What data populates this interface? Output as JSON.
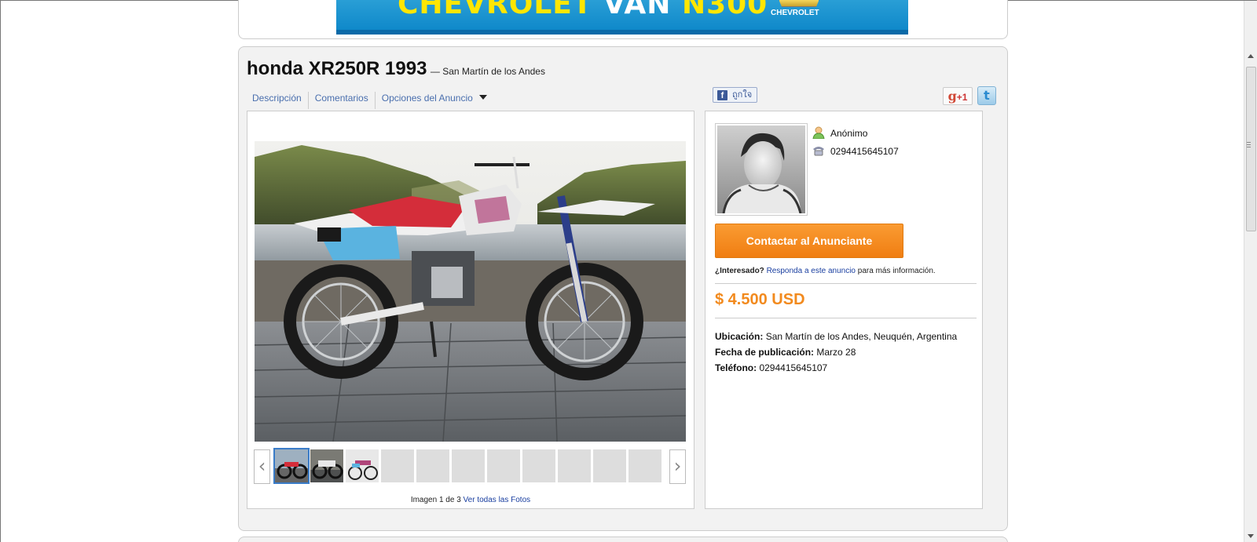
{
  "banner": {
    "text_brand": "CHEVROLET",
    "text_van": "VAN",
    "text_model": "N300",
    "brand_label": "CHEVROLET"
  },
  "listing": {
    "title": "honda XR250R 1993",
    "location_sub": "— San Martín de los Andes",
    "tabs": [
      {
        "label": "Descripción"
      },
      {
        "label": "Comentarios"
      },
      {
        "label": "Opciones del Anuncio"
      }
    ],
    "fb_like": "ถูกใจ",
    "fb_icon": "f",
    "gplus_g": "g",
    "gplus_label": "+1",
    "twitter_icon": "t"
  },
  "gallery": {
    "prev_icon": "‹",
    "next_icon": "›",
    "counter_prefix": "Imagen 1 de 3",
    "view_all": "Ver todas las Fotos"
  },
  "seller": {
    "name": "Anónimo",
    "phone": "0294415645107",
    "contact_button": "Contactar al Anunciante",
    "interest_bold": "¿Interesado?",
    "interest_link": "Responda a este anuncio",
    "interest_tail": "para más información.",
    "price": "$ 4.500 USD",
    "location_label": "Ubicación:",
    "location_value": "San Martín de los Andes, Neuquén, Argentina",
    "date_label": "Fecha de publicación:",
    "date_value": "Marzo 28",
    "phone_label": "Teléfono:",
    "phone_value": "0294415645107"
  },
  "colors": {
    "accent_orange": "#f28a1e",
    "link_blue": "#4a6fae"
  }
}
